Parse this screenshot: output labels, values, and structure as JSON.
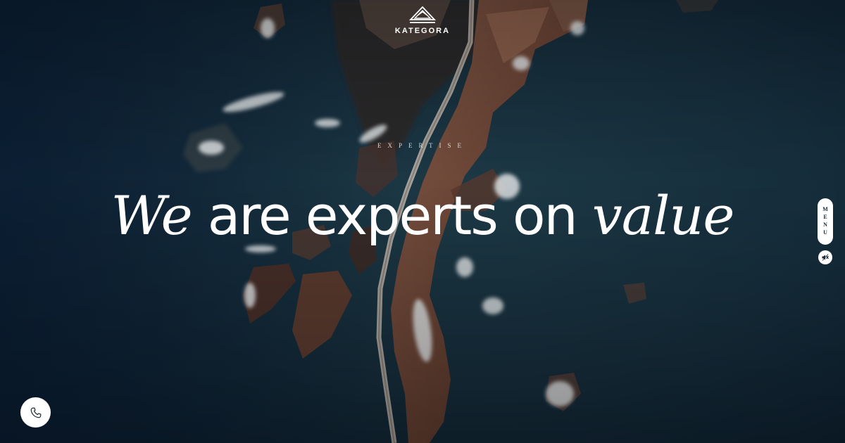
{
  "brand": {
    "name": "KATEGORA",
    "logo_icon": "mountain-logo-icon"
  },
  "hero": {
    "eyebrow": "EXPERTISE",
    "headline_parts": [
      "We",
      " are experts on ",
      "value"
    ],
    "background": "aerial-coastline-photo"
  },
  "menu": {
    "label": "MENU"
  },
  "controls": {
    "sound_icon": "sound-muted-icon",
    "call_icon": "phone-icon"
  },
  "colors": {
    "ocean": "#12283a",
    "rock": "#7a5140",
    "text": "#ffffff",
    "pill_text": "#1b2a36"
  }
}
